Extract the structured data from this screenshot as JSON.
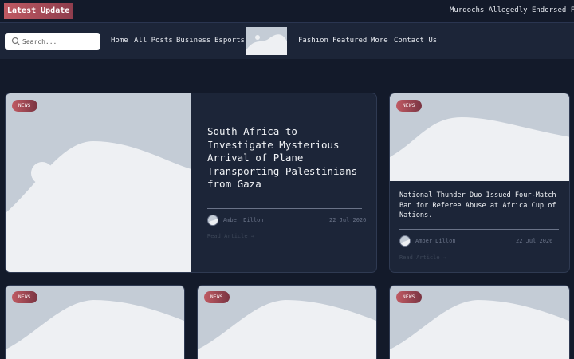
{
  "ticker": {
    "label": "Latest Update",
    "headline": "Murdochs Allegedly Endorsed Fo"
  },
  "nav": {
    "search_placeholder": "Search...",
    "items": [
      "Home",
      "All Posts",
      "Business",
      "Esports",
      "Fashion",
      "Featured",
      "More",
      "Contact Us"
    ]
  },
  "colors": {
    "page_bg": "#131a2a",
    "card_bg": "#1c2538",
    "accent": "#c05a63",
    "placeholder": "#c4ccd6"
  },
  "featured": {
    "badge": "NEWS",
    "title": "South Africa to Investigate Mysterious Arrival of Plane Transporting Palestinians from Gaza",
    "author": "Amber Dillon",
    "date": "22 Jul 2026",
    "read_more": "Read Article →"
  },
  "side": {
    "badge": "NEWS",
    "title": "National Thunder Duo Issued Four-Match Ban for Referee Abuse at Africa Cup of Nations.",
    "author": "Amber Dillon",
    "date": "22 Jul 2026",
    "read_more": "Read Article →"
  },
  "row_cards": [
    {
      "badge": "NEWS"
    },
    {
      "badge": "NEWS"
    },
    {
      "badge": "NEWS"
    }
  ]
}
